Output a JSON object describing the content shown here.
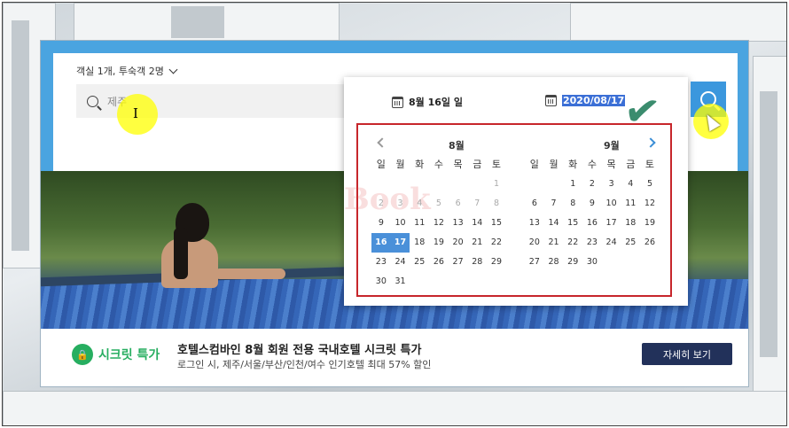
{
  "header": {
    "guests_label": "객실 1개, 투숙객 2명"
  },
  "search": {
    "value": "제주"
  },
  "dates": {
    "checkin": "8월 16일 일",
    "checkout": "2020/08/17"
  },
  "calendar": {
    "weekdays": [
      "일",
      "월",
      "화",
      "수",
      "목",
      "금",
      "토"
    ],
    "months": [
      {
        "title": "8월",
        "days": [
          {
            "t": "",
            "c": "e"
          },
          {
            "t": "",
            "c": "e"
          },
          {
            "t": "",
            "c": "e"
          },
          {
            "t": "",
            "c": "e"
          },
          {
            "t": "",
            "c": "e"
          },
          {
            "t": "",
            "c": "e"
          },
          {
            "t": "1",
            "c": "past"
          },
          {
            "t": "2",
            "c": "past"
          },
          {
            "t": "3",
            "c": "past"
          },
          {
            "t": "4",
            "c": "past"
          },
          {
            "t": "5",
            "c": "past"
          },
          {
            "t": "6",
            "c": "past"
          },
          {
            "t": "7",
            "c": "past"
          },
          {
            "t": "8",
            "c": "past"
          },
          {
            "t": "9",
            "c": ""
          },
          {
            "t": "10",
            "c": ""
          },
          {
            "t": "11",
            "c": ""
          },
          {
            "t": "12",
            "c": ""
          },
          {
            "t": "13",
            "c": ""
          },
          {
            "t": "14",
            "c": ""
          },
          {
            "t": "15",
            "c": ""
          },
          {
            "t": "16",
            "c": "sel"
          },
          {
            "t": "17",
            "c": "sel"
          },
          {
            "t": "18",
            "c": ""
          },
          {
            "t": "19",
            "c": ""
          },
          {
            "t": "20",
            "c": ""
          },
          {
            "t": "21",
            "c": ""
          },
          {
            "t": "22",
            "c": ""
          },
          {
            "t": "23",
            "c": ""
          },
          {
            "t": "24",
            "c": ""
          },
          {
            "t": "25",
            "c": ""
          },
          {
            "t": "26",
            "c": ""
          },
          {
            "t": "27",
            "c": ""
          },
          {
            "t": "28",
            "c": ""
          },
          {
            "t": "29",
            "c": ""
          },
          {
            "t": "30",
            "c": ""
          },
          {
            "t": "31",
            "c": ""
          }
        ]
      },
      {
        "title": "9월",
        "days": [
          {
            "t": "",
            "c": "e"
          },
          {
            "t": "",
            "c": "e"
          },
          {
            "t": "1",
            "c": ""
          },
          {
            "t": "2",
            "c": ""
          },
          {
            "t": "3",
            "c": ""
          },
          {
            "t": "4",
            "c": ""
          },
          {
            "t": "5",
            "c": ""
          },
          {
            "t": "6",
            "c": ""
          },
          {
            "t": "7",
            "c": ""
          },
          {
            "t": "8",
            "c": ""
          },
          {
            "t": "9",
            "c": ""
          },
          {
            "t": "10",
            "c": ""
          },
          {
            "t": "11",
            "c": ""
          },
          {
            "t": "12",
            "c": ""
          },
          {
            "t": "13",
            "c": ""
          },
          {
            "t": "14",
            "c": ""
          },
          {
            "t": "15",
            "c": ""
          },
          {
            "t": "16",
            "c": ""
          },
          {
            "t": "17",
            "c": ""
          },
          {
            "t": "18",
            "c": ""
          },
          {
            "t": "19",
            "c": ""
          },
          {
            "t": "20",
            "c": ""
          },
          {
            "t": "21",
            "c": ""
          },
          {
            "t": "22",
            "c": ""
          },
          {
            "t": "23",
            "c": ""
          },
          {
            "t": "24",
            "c": ""
          },
          {
            "t": "25",
            "c": ""
          },
          {
            "t": "26",
            "c": ""
          },
          {
            "t": "27",
            "c": ""
          },
          {
            "t": "28",
            "c": ""
          },
          {
            "t": "29",
            "c": ""
          },
          {
            "t": "30",
            "c": ""
          }
        ]
      }
    ]
  },
  "promo": {
    "badge": "시크릿 특가",
    "title": "호텔스컴바인 8월 회원 전용 국내호텔 시크릿 특가",
    "subtitle": "로그인 시, 제주/서울/부산/인천/여수 인기호텔 최대 57% 할인",
    "button": "자세히 보기"
  },
  "colors": {
    "accent": "#3b97dd",
    "selected_day": "#4a90d9",
    "promo_green": "#27ae60",
    "button_navy": "#22315a",
    "highlight_frame": "#c7262b"
  },
  "icons": {
    "search": "search-icon",
    "calendar": "calendar-icon",
    "lock": "lock-icon",
    "chevron": "chevron-down-icon"
  }
}
